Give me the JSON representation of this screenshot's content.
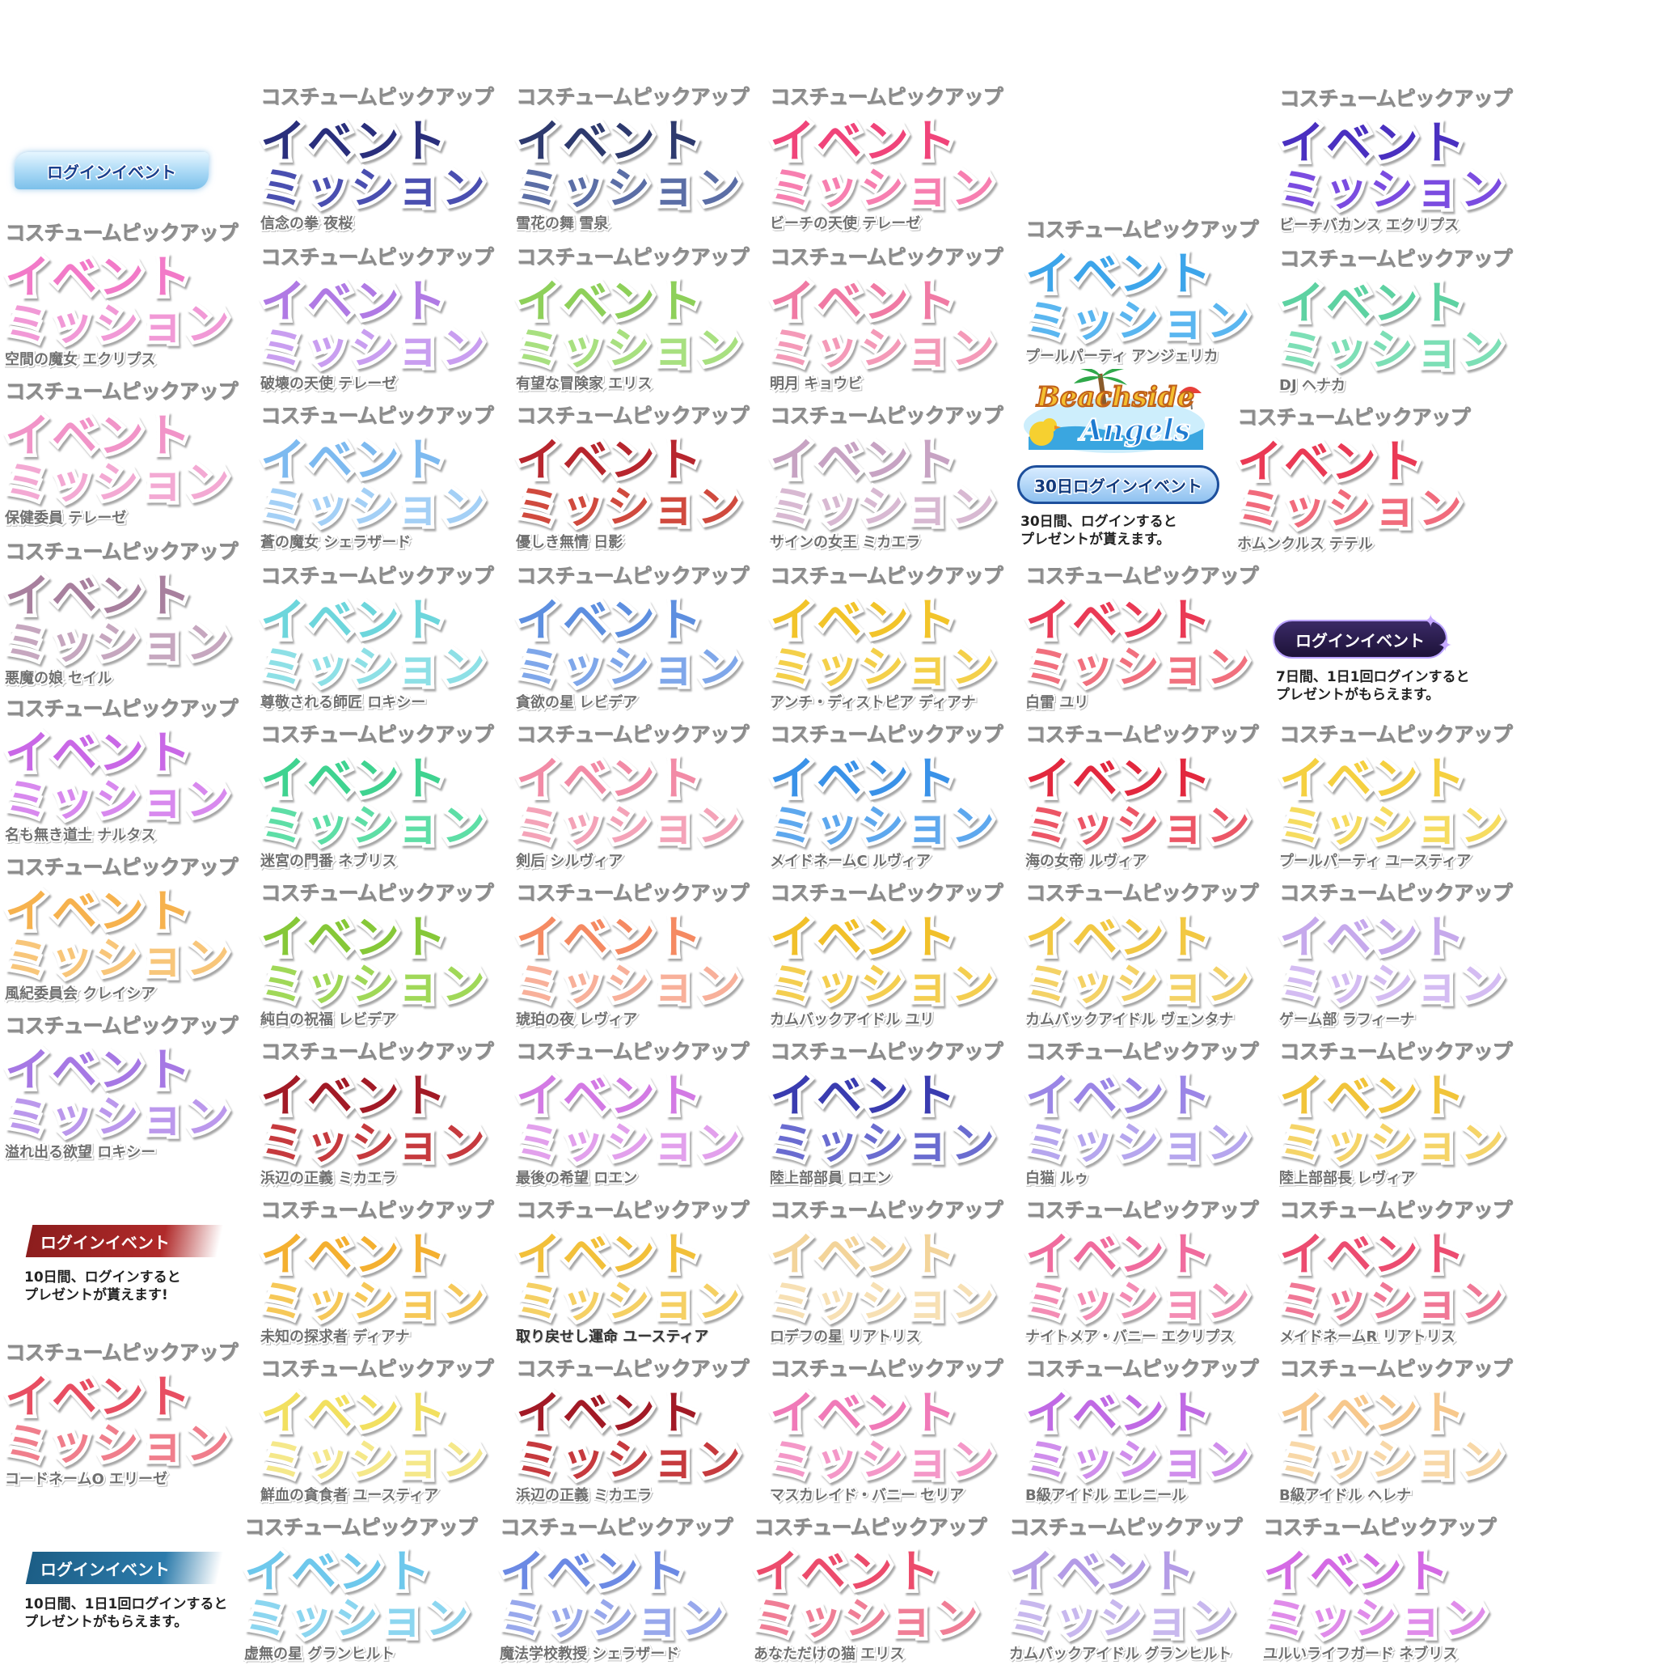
{
  "header_label": "コスチュームピックアップ",
  "line1": "イベント",
  "line2": "ミッション",
  "banners": [
    {
      "sub": "信念の拳 夜桜",
      "c1": "#2a2f7c",
      "c2": "#4a4fb0"
    },
    {
      "sub": "雪花の舞 雪泉",
      "c1": "#2e3a6e",
      "c2": "#5b6ea6"
    },
    {
      "sub": "ビーチの天使 テレーゼ",
      "c1": "#f0447a",
      "c2": "#f77fb0"
    },
    {
      "sub": "ビーチバカンス エクリプス",
      "c1": "#4a30c0",
      "c2": "#7b4ce0"
    },
    {
      "sub": "空間の魔女 エクリプス",
      "c1": "#f27ac8",
      "c2": "#f199d6"
    },
    {
      "sub": "破壊の天使 テレーゼ",
      "c1": "#b07ae4",
      "c2": "#c99ef0"
    },
    {
      "sub": "有望な冒険家 エリス",
      "c1": "#8ed05a",
      "c2": "#a8e080"
    },
    {
      "sub": "明月 キョウビ",
      "c1": "#f07aa4",
      "c2": "#f49ab8"
    },
    {
      "sub": "プールパーティ アンジェリカ",
      "c1": "#3da5ea",
      "c2": "#5ab6f0"
    },
    {
      "sub": "DJ ヘナカ",
      "c1": "#5ed2a2",
      "c2": "#7ddfb6"
    },
    {
      "sub": "保健委員 テレーゼ",
      "c1": "#f194c8",
      "c2": "#f3a9d3"
    },
    {
      "sub": "蒼の魔女 シェラザード",
      "c1": "#7dbaf0",
      "c2": "#a4d0f6"
    },
    {
      "sub": "優しき無情 日影",
      "c1": "#b7262e",
      "c2": "#d04a3e"
    },
    {
      "sub": "サインの女王 ミカエラ",
      "c1": "#c7a3c3",
      "c2": "#d8b9d2"
    },
    {
      "sub": "ホムンクルス テテル",
      "c1": "#ea3a55",
      "c2": "#f16b7c"
    },
    {
      "sub": "悪魔の娘 セイル",
      "c1": "#a8809e",
      "c2": "#c6a7bf"
    },
    {
      "sub": "尊敬される師匠 ロキシー",
      "c1": "#6dd6dc",
      "c2": "#8ee0e6"
    },
    {
      "sub": "貪欲の星 レビデア",
      "c1": "#5d8fe0",
      "c2": "#7fa7ea"
    },
    {
      "sub": "アンチ・ディストピア ディアナ",
      "c1": "#f2c42a",
      "c2": "#f4d04a"
    },
    {
      "sub": "白雷 ユリ",
      "c1": "#ea3a55",
      "c2": "#f1707e"
    },
    {
      "sub": "名も無き道士 ナルタス",
      "c1": "#c968e6",
      "c2": "#d889ee"
    },
    {
      "sub": "迷宮の門番 ネブリス",
      "c1": "#3fd390",
      "c2": "#5edea6"
    },
    {
      "sub": "剣后 シルヴィア",
      "c1": "#f28ba6",
      "c2": "#f4a3b8"
    },
    {
      "sub": "メイドネームC ルヴィア",
      "c1": "#3a92e8",
      "c2": "#5ea8ee"
    },
    {
      "sub": "海の女帝 ルヴィア",
      "c1": "#e2283e",
      "c2": "#ec5666"
    },
    {
      "sub": "プールパーティ ユースティア",
      "c1": "#f5d040",
      "c2": "#f6dc60"
    },
    {
      "sub": "風紀委員会 クレイシア",
      "c1": "#f6b24e",
      "c2": "#f8c67a"
    },
    {
      "sub": "純白の祝福 レビデア",
      "c1": "#86c838",
      "c2": "#a0d858"
    },
    {
      "sub": "琥珀の夜 レヴィア",
      "c1": "#f58a62",
      "c2": "#f8b09a"
    },
    {
      "sub": "カムバックアイドル ユリ",
      "c1": "#f1c02a",
      "c2": "#f4ce50"
    },
    {
      "sub": "カムバックアイドル ヴェンタナ",
      "c1": "#f2c843",
      "c2": "#f4d266"
    },
    {
      "sub": "ゲーム部 ラフィーナ",
      "c1": "#c6a9ec",
      "c2": "#d4bcf2"
    },
    {
      "sub": "溢れ出る欲望 ロキシー",
      "c1": "#a678e4",
      "c2": "#bb98ec"
    },
    {
      "sub": "浜辺の正義 ミカエラ",
      "c1": "#a21a26",
      "c2": "#c63a3e"
    },
    {
      "sub": "最後の希望 ロエン",
      "c1": "#d37ae4",
      "c2": "#e2a0ec"
    },
    {
      "sub": "陸上部部員 ロエン",
      "c1": "#3a3cb0",
      "c2": "#6a6cd0"
    },
    {
      "sub": "白猫 ルゥ",
      "c1": "#9b86e6",
      "c2": "#b6a6ee"
    },
    {
      "sub": "陸上部部長 レヴィア",
      "c1": "#f1c43a",
      "c2": "#f5d468"
    },
    {
      "sub": "未知の探求者 ディアナ",
      "c1": "#f4b030",
      "c2": "#f6c858"
    },
    {
      "sub": "取り戻せし運命 ユースティア",
      "c1": "#f2c03a",
      "c2": "#f5d064",
      "dark": true
    },
    {
      "sub": "ロデフの星 リアトリス",
      "c1": "#f3d49a",
      "c2": "#f7e0b4"
    },
    {
      "sub": "ナイトメア・バニー エクリプス",
      "c1": "#f06c9e",
      "c2": "#f48cb4"
    },
    {
      "sub": "メイドネームR リアトリス",
      "c1": "#ec4c70",
      "c2": "#f07896"
    },
    {
      "sub": "コードネームO エリーゼ",
      "c1": "#e84e62",
      "c2": "#f07e8c"
    },
    {
      "sub": "鮮血の貪食者 ユースティア",
      "c1": "#f2e060",
      "c2": "#f5e88a"
    },
    {
      "sub": "浜辺の正義 ミカエラ",
      "c1": "#a21a26",
      "c2": "#c63a3e"
    },
    {
      "sub": "マスカレイド・バニー セリア",
      "c1": "#f07ab8",
      "c2": "#f498c8"
    },
    {
      "sub": "B級アイドル エレニール",
      "c1": "#c06ae4",
      "c2": "#d08eec"
    },
    {
      "sub": "B級アイドル ヘレナ",
      "c1": "#f7c88c",
      "c2": "#f8d8a8"
    },
    {
      "sub": "虚無の星 グランヒルト",
      "c1": "#6ec8ec",
      "c2": "#8cd6f0"
    },
    {
      "sub": "魔法学校教授 シェラザード",
      "c1": "#6c8ae4",
      "c2": "#98a8ec"
    },
    {
      "sub": "あなただけの猫 エリス",
      "c1": "#ec4c6c",
      "c2": "#f07e96"
    },
    {
      "sub": "カムバックアイドル グランヒルト",
      "c1": "#b49ce6",
      "c2": "#c8b8ee"
    },
    {
      "sub": "ユルいライフガード ネブリス",
      "c1": "#d46ae4",
      "c2": "#e08cea"
    }
  ],
  "login": {
    "ice_label": "ログインイベント",
    "beach_logo_line1": "Beachside",
    "beach_logo_line2": "Angels",
    "thirty_label": "30日ログインイベント",
    "thirty_notice": [
      "30日間、ログインすると",
      "プレゼントが貰えます。"
    ],
    "seven_label": "ログインイベント",
    "seven_notice": [
      "7日間、1日1回ログインすると",
      "プレゼントがもらえます。"
    ],
    "ten_label": "ログインイベント",
    "ten_notice": [
      "10日間、ログインすると",
      "プレゼントが貰えます!"
    ],
    "ten2_label": "ログインイベント",
    "ten2_notice": [
      "10日間、1日1回ログインすると",
      "プレゼントがもらえます。"
    ]
  }
}
